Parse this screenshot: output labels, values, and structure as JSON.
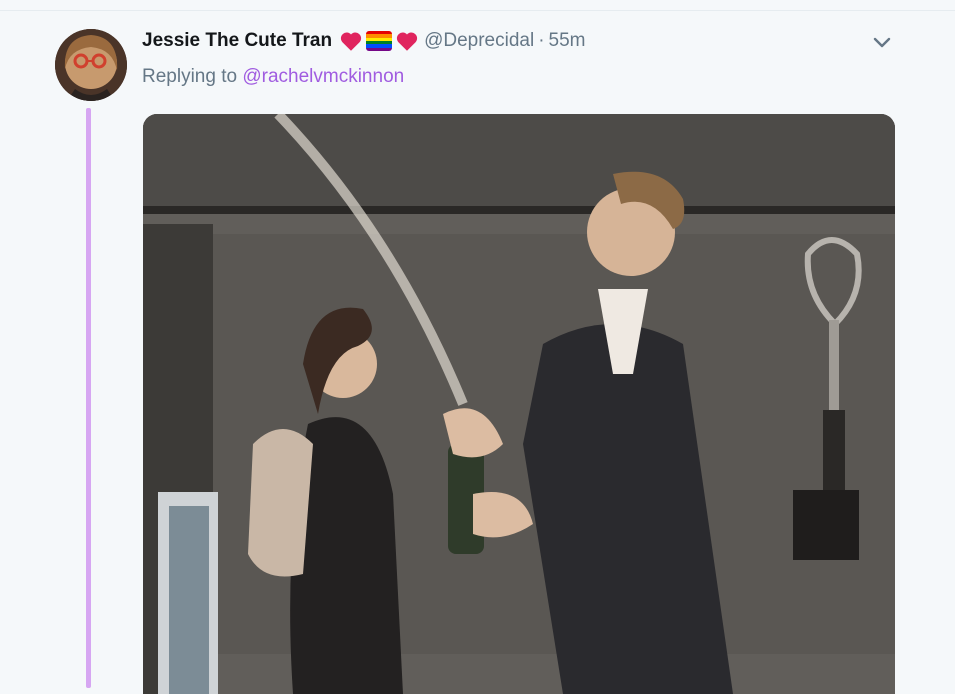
{
  "tweet": {
    "display_name": "Jessie The Cute Tran",
    "handle": "@Deprecidal",
    "separator": "·",
    "time": "55m",
    "replying_prefix": "Replying to",
    "replying_to": "@rachelvmckinnon",
    "emojis": [
      "red-heart",
      "rainbow-flag",
      "red-heart"
    ]
  },
  "colors": {
    "thread_line": "#d6a6f2",
    "mention": "#a05ce0",
    "secondary_text": "#657786",
    "heart": "#e0245e"
  },
  "media": {
    "type": "animated-gif",
    "icon": "gif-thumbnail"
  }
}
